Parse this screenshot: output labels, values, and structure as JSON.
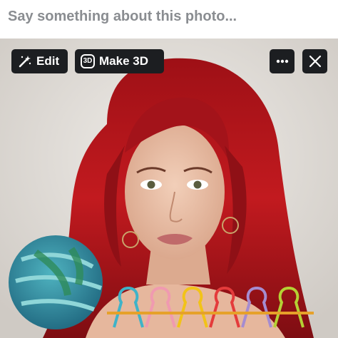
{
  "caption": {
    "placeholder": "Say something about this photo..."
  },
  "toolbar": {
    "edit_label": "Edit",
    "make3d_label": "Make 3D",
    "make3d_icon_text": "3D",
    "more_icon": "more-horizontal-icon",
    "close_icon": "close-icon",
    "edit_icon": "magic-wand-icon"
  },
  "colors": {
    "button_bg": "#1c1e21",
    "caption_text": "#8a8d91",
    "hair": "#b0171c",
    "background": "#e3e0dc"
  }
}
